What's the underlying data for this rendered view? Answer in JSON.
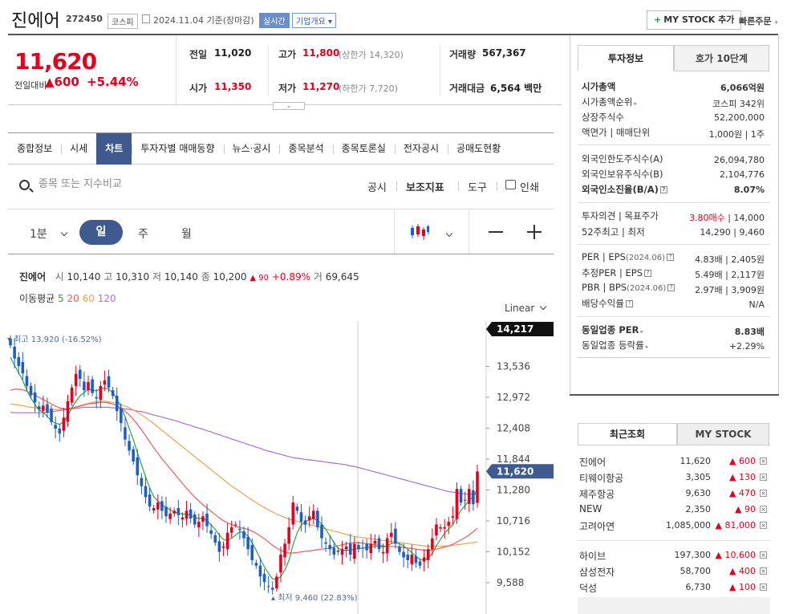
{
  "header": {
    "name": "진에어",
    "code": "272450",
    "market": "코스피",
    "date": "2024.11.04  기준(장마감)",
    "realtime": "실시간",
    "company": "기업개요 ▾",
    "mystock": "MY STOCK 추가",
    "quick_order": "빠른주문"
  },
  "price": {
    "current": "11,620",
    "prev_label": "전일대비",
    "change": "▲600",
    "change_pct": "+5.44%"
  },
  "quote": {
    "prev_label": "전일",
    "prev": "11,020",
    "open_label": "시가",
    "open": "11,350",
    "high_label": "고가",
    "high": "11,800",
    "high_sub": "(상한가 14,320)",
    "low_label": "저가",
    "low": "11,270",
    "low_sub": "(하한가 7,720)",
    "vol_label": "거래량",
    "vol": "567,367",
    "amt_label": "거래대금",
    "amt": "6,564",
    "amt_unit": "백만"
  },
  "tabs": [
    "종합정보",
    "시세",
    "차트",
    "투자자별 매매동향",
    "뉴스·공시",
    "종목분석",
    "종목토론실",
    "전자공시",
    "공매도현황"
  ],
  "search": {
    "placeholder": "종목 또는 지수비교"
  },
  "tools": {
    "notice": "공시",
    "indicator": "보조지표",
    "tool": "도구",
    "print": "인쇄"
  },
  "periods": {
    "min": "1분",
    "day": "일",
    "week": "주",
    "month": "월"
  },
  "ohlc": {
    "name": "진에어",
    "o_lbl": "시",
    "o": "10,140",
    "h_lbl": "고",
    "h": "10,310",
    "l_lbl": "저",
    "l": "10,140",
    "c_lbl": "종",
    "c": "10,200",
    "chg": "▲ 90",
    "pct": "+0.89%",
    "v_lbl": "거",
    "v": "69,645"
  },
  "ma": {
    "label": "이동평균",
    "p5": "5",
    "p20": "20",
    "p60": "60",
    "p120": "120"
  },
  "chart_data": {
    "type": "candlestick",
    "scale": "Linear",
    "y_ticks": [
      "13,536",
      "12,972",
      "12,408",
      "11,844",
      "11,280",
      "10,716",
      "10,152",
      "9,588"
    ],
    "ylim": [
      9400,
      14400
    ],
    "high_label": "▾ 최고 13,920 (-16.52%)",
    "low_label": "▴ 최저 9,460 (22.83%)",
    "current_tag": "11,620",
    "top_tag": "14,217",
    "colors": {
      "up": "#e6001e",
      "down": "#1a5fc7",
      "ma5": "#2aa83a",
      "ma20": "#ee5a5a",
      "ma60": "#f0a24a",
      "ma120": "#a86ee0"
    },
    "closes": [
      13920,
      13680,
      13540,
      13410,
      13180,
      13010,
      12880,
      12750,
      12820,
      12690,
      12520,
      12400,
      12310,
      12600,
      12900,
      13150,
      13400,
      13310,
      13100,
      13250,
      13050,
      12950,
      13180,
      13280,
      13150,
      13000,
      12720,
      12500,
      12200,
      12000,
      11800,
      11550,
      11350,
      11150,
      10980,
      10950,
      11050,
      10900,
      10800,
      10850,
      10900,
      10820,
      10780,
      10900,
      10760,
      10650,
      10700,
      10800,
      10620,
      10480,
      10320,
      10150,
      10250,
      10500,
      10600,
      10650,
      10550,
      10400,
      10200,
      10000,
      9900,
      9700,
      9600,
      9520,
      9460,
      9700,
      10100,
      10300,
      10600,
      11050,
      10900,
      10700,
      10650,
      10800,
      10900,
      10600,
      10400,
      10300,
      10200,
      10100,
      10150,
      10200,
      10250,
      10100,
      10300,
      10200,
      10220,
      10180,
      10300,
      10350,
      10200,
      10150,
      10400,
      10500,
      10300,
      10150,
      10050,
      10000,
      10100,
      9950,
      9900,
      10050,
      10200,
      10400,
      10650,
      10600,
      10600,
      10700,
      10800,
      11300,
      11050,
      11100,
      11300,
      11020,
      11620
    ],
    "ma5": [
      13700,
      13560,
      13420,
      13280,
      13100,
      12960,
      12840,
      12740,
      12700,
      12620,
      12540,
      12500,
      12480,
      12520,
      12640,
      12780,
      12900,
      13000,
      13060,
      13120,
      13100,
      13090,
      13120,
      13140,
      13120,
      13060,
      12940,
      12800,
      12620,
      12400,
      12200,
      11960,
      11740,
      11520,
      11320,
      11160,
      11080,
      11010,
      10960,
      10920,
      10880,
      10860,
      10840,
      10840,
      10820,
      10780,
      10760,
      10760,
      10720,
      10640,
      10560,
      10460,
      10380,
      10360,
      10400,
      10460,
      10520,
      10500,
      10440,
      10320,
      10180,
      10020,
      9880,
      9760,
      9660,
      9640,
      9700,
      9820,
      10000,
      10280,
      10500,
      10640,
      10700,
      10740,
      10760,
      10720,
      10660,
      10560,
      10440,
      10320,
      10220,
      10180,
      10180,
      10180,
      10200,
      10210,
      10220,
      10230,
      10240,
      10250,
      10250,
      10240,
      10260,
      10300,
      10320,
      10300,
      10260,
      10200,
      10140,
      10070,
      10010,
      10000,
      10040,
      10120,
      10260,
      10380,
      10490,
      10570,
      10640,
      10790,
      10910,
      11000,
      11090,
      11160,
      11290
    ],
    "ma20": [
      13100,
      13120,
      13120,
      13110,
      13080,
      13050,
      13010,
      12970,
      12930,
      12890,
      12850,
      12810,
      12780,
      12760,
      12760,
      12770,
      12790,
      12810,
      12830,
      12850,
      12860,
      12870,
      12880,
      12880,
      12870,
      12850,
      12820,
      12780,
      12720,
      12650,
      12570,
      12480,
      12380,
      12270,
      12160,
      12050,
      11950,
      11850,
      11760,
      11670,
      11580,
      11490,
      11400,
      11310,
      11230,
      11150,
      11080,
      11010,
      10950,
      10890,
      10830,
      10770,
      10720,
      10680,
      10650,
      10620,
      10600,
      10580,
      10560,
      10530,
      10490,
      10440,
      10390,
      10330,
      10270,
      10220,
      10180,
      10150,
      10130,
      10130,
      10140,
      10150,
      10160,
      10170,
      10180,
      10190,
      10200,
      10210,
      10220,
      10240,
      10260,
      10280,
      10300,
      10310,
      10320,
      10320,
      10310,
      10300,
      10290,
      10280,
      10270,
      10260,
      10250,
      10250,
      10250,
      10240,
      10230,
      10220,
      10210,
      10200,
      10190,
      10180,
      10180,
      10190,
      10200,
      10220,
      10240,
      10260,
      10290,
      10330,
      10370,
      10410,
      10460,
      10520,
      10580
    ],
    "ma60": [
      12850,
      12840,
      12830,
      12820,
      12800,
      12790,
      12780,
      12770,
      12760,
      12750,
      12750,
      12750,
      12750,
      12760,
      12770,
      12780,
      12800,
      12820,
      12840,
      12860,
      12880,
      12890,
      12900,
      12900,
      12890,
      12880,
      12860,
      12840,
      12810,
      12780,
      12740,
      12700,
      12650,
      12600,
      12550,
      12490,
      12430,
      12370,
      12310,
      12250,
      12190,
      12130,
      12070,
      12010,
      11950,
      11890,
      11830,
      11770,
      11710,
      11650,
      11590,
      11530,
      11470,
      11410,
      11350,
      11300,
      11250,
      11200,
      11150,
      11100,
      11050,
      11000,
      10960,
      10920,
      10880,
      10840,
      10810,
      10780,
      10750,
      10730,
      10710,
      10690,
      10670,
      10650,
      10630,
      10610,
      10590,
      10570,
      10550,
      10530,
      10510,
      10490,
      10470,
      10450,
      10430,
      10420,
      10410,
      10400,
      10390,
      10380,
      10370,
      10360,
      10350,
      10340,
      10330,
      10320,
      10310,
      10300,
      10290,
      10280,
      10270,
      10260,
      10250,
      10250,
      10250,
      10250,
      10260,
      10260,
      10270,
      10280,
      10290,
      10300,
      10310,
      10320,
      10330
    ],
    "ma120": [
      12700,
      12690,
      12690,
      12690,
      12690,
      12690,
      12690,
      12690,
      12690,
      12700,
      12710,
      12720,
      12730,
      12740,
      12750,
      12760,
      12770,
      12780,
      12790,
      12790,
      12790,
      12790,
      12790,
      12790,
      12790,
      12780,
      12780,
      12770,
      12760,
      12750,
      12740,
      12720,
      12710,
      12690,
      12670,
      12650,
      12630,
      12610,
      12590,
      12570,
      12550,
      12530,
      12500,
      12480,
      12460,
      12430,
      12410,
      12390,
      12360,
      12340,
      12310,
      12290,
      12260,
      12240,
      12210,
      12190,
      12160,
      12140,
      12110,
      12090,
      12060,
      12040,
      12010,
      11990,
      11970,
      11950,
      11930,
      11910,
      11890,
      11870,
      11860,
      11850,
      11840,
      11830,
      11820,
      11810,
      11800,
      11790,
      11780,
      11770,
      11760,
      11750,
      11740,
      11720,
      11710,
      11690,
      11670,
      11650,
      11630,
      11610,
      11590,
      11570,
      11550,
      11530,
      11510,
      11490,
      11470,
      11450,
      11430,
      11410,
      11390,
      11370,
      11350,
      11330,
      11310,
      11290,
      11270,
      11250,
      11240,
      11230,
      11220,
      11210,
      11200,
      11200,
      11200
    ]
  },
  "right_panel": {
    "tab_info": "투자정보",
    "tab_hoga": "호가 10단계",
    "rows1": [
      {
        "label": "시가총액",
        "value": "6,066억원"
      },
      {
        "label": "시가총액순위",
        "value": "코스피 342위"
      },
      {
        "label": "상장주식수",
        "value": "52,200,000"
      },
      {
        "label": "액면가 | 매매단위",
        "value": "1,000원 | 1주"
      }
    ],
    "rows2": [
      {
        "label": "외국인한도주식수(A)",
        "value": "26,094,780"
      },
      {
        "label": "외국인보유주식수(B)",
        "value": "2,104,776"
      },
      {
        "label": "외국인소진율(B/A)",
        "value": "8.07%"
      }
    ],
    "opinion": {
      "label": "투자의견 | 목표주가",
      "value_red": "3.80매수",
      "value": "| 14,000"
    },
    "w52": {
      "label": "52주최고 | 최저",
      "value": "14,290 | 9,460"
    },
    "rows3": [
      {
        "label": "PER | EPS",
        "sub": "(2024.06)",
        "value": "4.83배 | 2,405원"
      },
      {
        "label": "추정PER | EPS",
        "sub": "",
        "value": "5.49배 | 2,117원"
      },
      {
        "label": "PBR | BPS",
        "sub": "(2024.06)",
        "value": "2.97배 | 3,909원"
      },
      {
        "label": "배당수익률",
        "sub": "",
        "value": "N/A"
      }
    ],
    "industry_per": {
      "label": "동일업종 PER",
      "value": "8.83배"
    },
    "industry_rate": {
      "label": "동일업종 등락률",
      "value": "+2.29%"
    }
  },
  "recent": {
    "tab_recent": "최근조회",
    "tab_mystock": "MY STOCK",
    "items": [
      {
        "name": "진에어",
        "price": "11,620",
        "chg": "▲ 600"
      },
      {
        "name": "티웨이항공",
        "price": "3,305",
        "chg": "▲ 130"
      },
      {
        "name": "제주항공",
        "price": "9,630",
        "chg": "▲ 470"
      },
      {
        "name": "NEW",
        "price": "2,350",
        "chg": "▲ 90"
      },
      {
        "name": "고려아연",
        "price": "1,085,000",
        "chg": "▲ 81,000"
      },
      {
        "name": "하이브",
        "price": "197,300",
        "chg": "▲ 10,600"
      },
      {
        "name": "삼성전자",
        "price": "58,700",
        "chg": "▲ 400"
      },
      {
        "name": "덕성",
        "price": "6,730",
        "chg": "▲ 100"
      }
    ]
  }
}
